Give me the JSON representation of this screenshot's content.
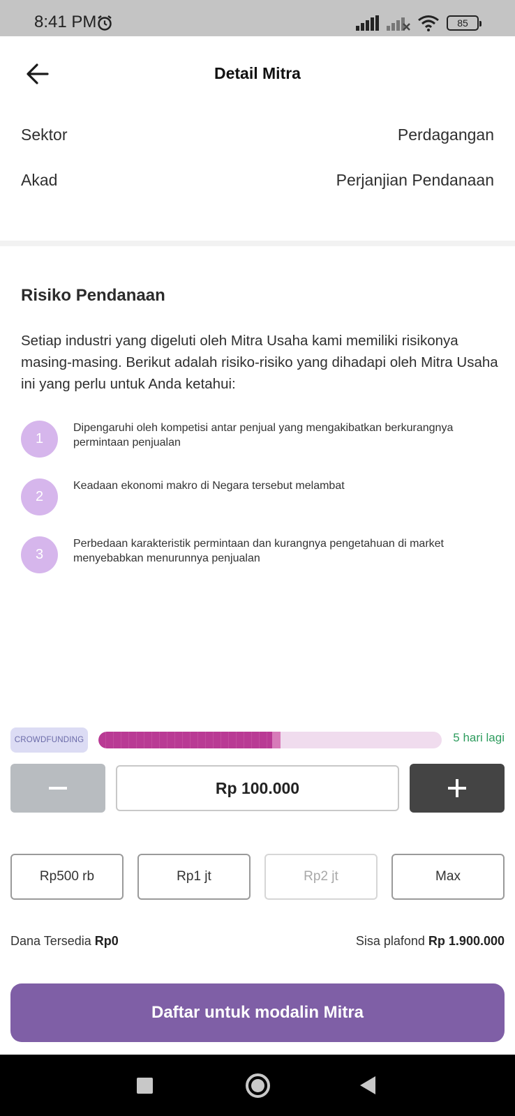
{
  "status_bar": {
    "time": "8:41 PM",
    "battery": "85"
  },
  "header": {
    "title": "Detail Mitra"
  },
  "details": [
    {
      "label": "Sektor",
      "value": "Perdagangan"
    },
    {
      "label": "Akad",
      "value": "Perjanjian Pendanaan"
    }
  ],
  "risk": {
    "title": "Risiko Pendanaan",
    "description": "Setiap industri yang digeluti oleh Mitra Usaha kami memiliki risikonya masing-masing. Berikut adalah risiko-risiko yang dihadapi oleh Mitra Usaha ini yang perlu untuk Anda ketahui:",
    "items": [
      {
        "number": "1",
        "text": "Dipengaruhi oleh kompetisi antar penjual yang mengakibatkan berkurangnya permintaan penjualan"
      },
      {
        "number": "2",
        "text": "Keadaan ekonomi makro di Negara tersebut melambat"
      },
      {
        "number": "3",
        "text": "Perbedaan karakteristik permintaan dan kurangnya pengetahuan di market menyebabkan menurunnya penjualan"
      }
    ]
  },
  "campaign": {
    "badge": "CROWDFUNDING",
    "progress_fraction": 0.53,
    "days_left": "5 hari lagi"
  },
  "amount": {
    "value": "Rp 100.000",
    "quick_options": [
      {
        "label": "Rp500 rb",
        "enabled": true
      },
      {
        "label": "Rp1 jt",
        "enabled": true
      },
      {
        "label": "Rp2 jt",
        "enabled": false
      },
      {
        "label": "Max",
        "enabled": true
      }
    ]
  },
  "funds": {
    "available_label": "Dana Tersedia",
    "available_value": "Rp0",
    "remaining_label": "Sisa plafond",
    "remaining_value": "Rp 1.900.000"
  },
  "cta": {
    "label": "Daftar untuk modalin Mitra"
  },
  "colors": {
    "accent": "#7f5fa6",
    "progress": "#b93a94",
    "progress_track": "#f0dcee",
    "risk_circle": "#d6b6ec",
    "days_left": "#2e9c5e"
  }
}
